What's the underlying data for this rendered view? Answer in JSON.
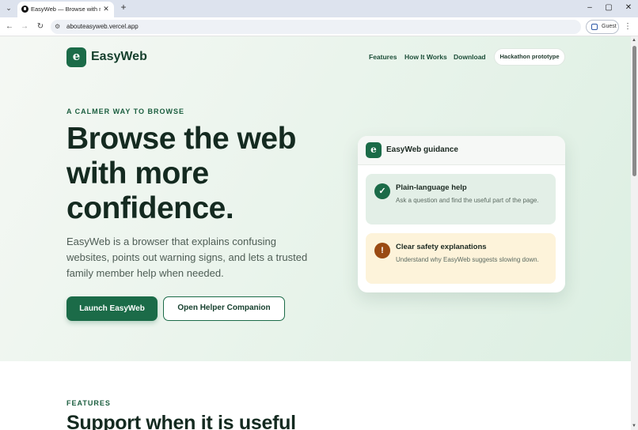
{
  "browser": {
    "tab_title": "EasyWeb — Browse with more confidence",
    "url": "abouteasyweb.vercel.app",
    "profile_label": "Guest"
  },
  "brand": {
    "logo_letter": "e",
    "name": "EasyWeb",
    "color": "#1b6b48"
  },
  "nav": {
    "links": [
      "Features",
      "How It Works",
      "Download"
    ],
    "pill": "Hackathon prototype"
  },
  "hero": {
    "eyebrow": "A CALMER WAY TO BROWSE",
    "headline": "Browse the web with more confidence.",
    "subcopy": "EasyWeb is a browser that explains confusing websites, points out warning signs, and lets a trusted family member help when needed.",
    "primary_cta": "Launch EasyWeb",
    "secondary_cta": "Open Helper Companion"
  },
  "guidance_card": {
    "logo_letter": "e",
    "title": "EasyWeb guidance",
    "items": [
      {
        "icon": "check-icon",
        "glyph": "✓",
        "title": "Plain-language help",
        "body": "Ask a question and find the useful part of the page.",
        "color": "#1b6b48"
      },
      {
        "icon": "warning-icon",
        "glyph": "!",
        "title": "Clear safety explanations",
        "body": "Understand why EasyWeb suggests slowing down.",
        "color": "#9a4a12"
      }
    ]
  },
  "features": {
    "eyebrow": "FEATURES",
    "heading": "Support when it is useful"
  }
}
